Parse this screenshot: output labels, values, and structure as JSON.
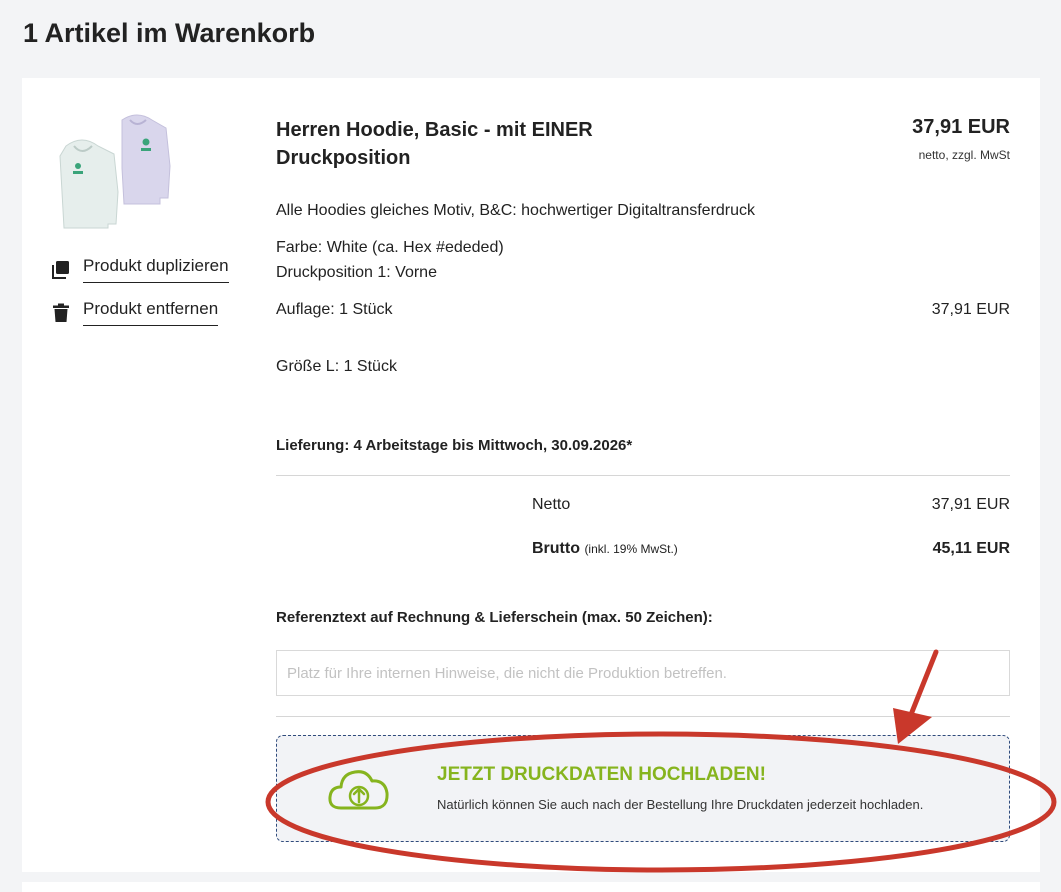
{
  "page": {
    "title": "1 Artikel im Warenkorb"
  },
  "item": {
    "title": "Herren Hoodie, Basic - mit EINER Druckposition",
    "price": "37,91 EUR",
    "price_note": "netto, zzgl. MwSt",
    "description": "Alle Hoodies gleiches Motiv, B&C: hochwertiger Digitaltransferdruck",
    "color": "Farbe: White (ca. Hex #ededed)",
    "print_position": "Druckposition 1: Vorne",
    "quantity_label": "Auflage: 1 Stück",
    "quantity_price": "37,91 EUR",
    "size": "Größe L: 1 Stück",
    "delivery": "Lieferung: 4 Arbeitstage bis Mittwoch, 30.09.2026*"
  },
  "actions": {
    "duplicate": "Produkt duplizieren",
    "remove": "Produkt entfernen"
  },
  "totals": {
    "net_label": "Netto",
    "net_value": "37,91 EUR",
    "gross_label": "Brutto",
    "gross_note": "(inkl. 19% MwSt.)",
    "gross_value": "45,11 EUR"
  },
  "reference": {
    "label": "Referenztext auf Rechnung & Lieferschein (max. 50 Zeichen):",
    "placeholder": "Platz für Ihre internen Hinweise, die nicht die Produktion betreffen.",
    "value": ""
  },
  "upload": {
    "title": "JETZT DRUCKDATEN HOCHLADEN!",
    "subtitle": "Natürlich können Sie auch nach der Bestellung Ihre Druckdaten jederzeit hochladen.",
    "icon": "cloud-upload-icon"
  },
  "colors": {
    "accent_green": "#86b41e",
    "annotation_red": "#c9382b",
    "dashed_border": "#2f4b7c"
  }
}
